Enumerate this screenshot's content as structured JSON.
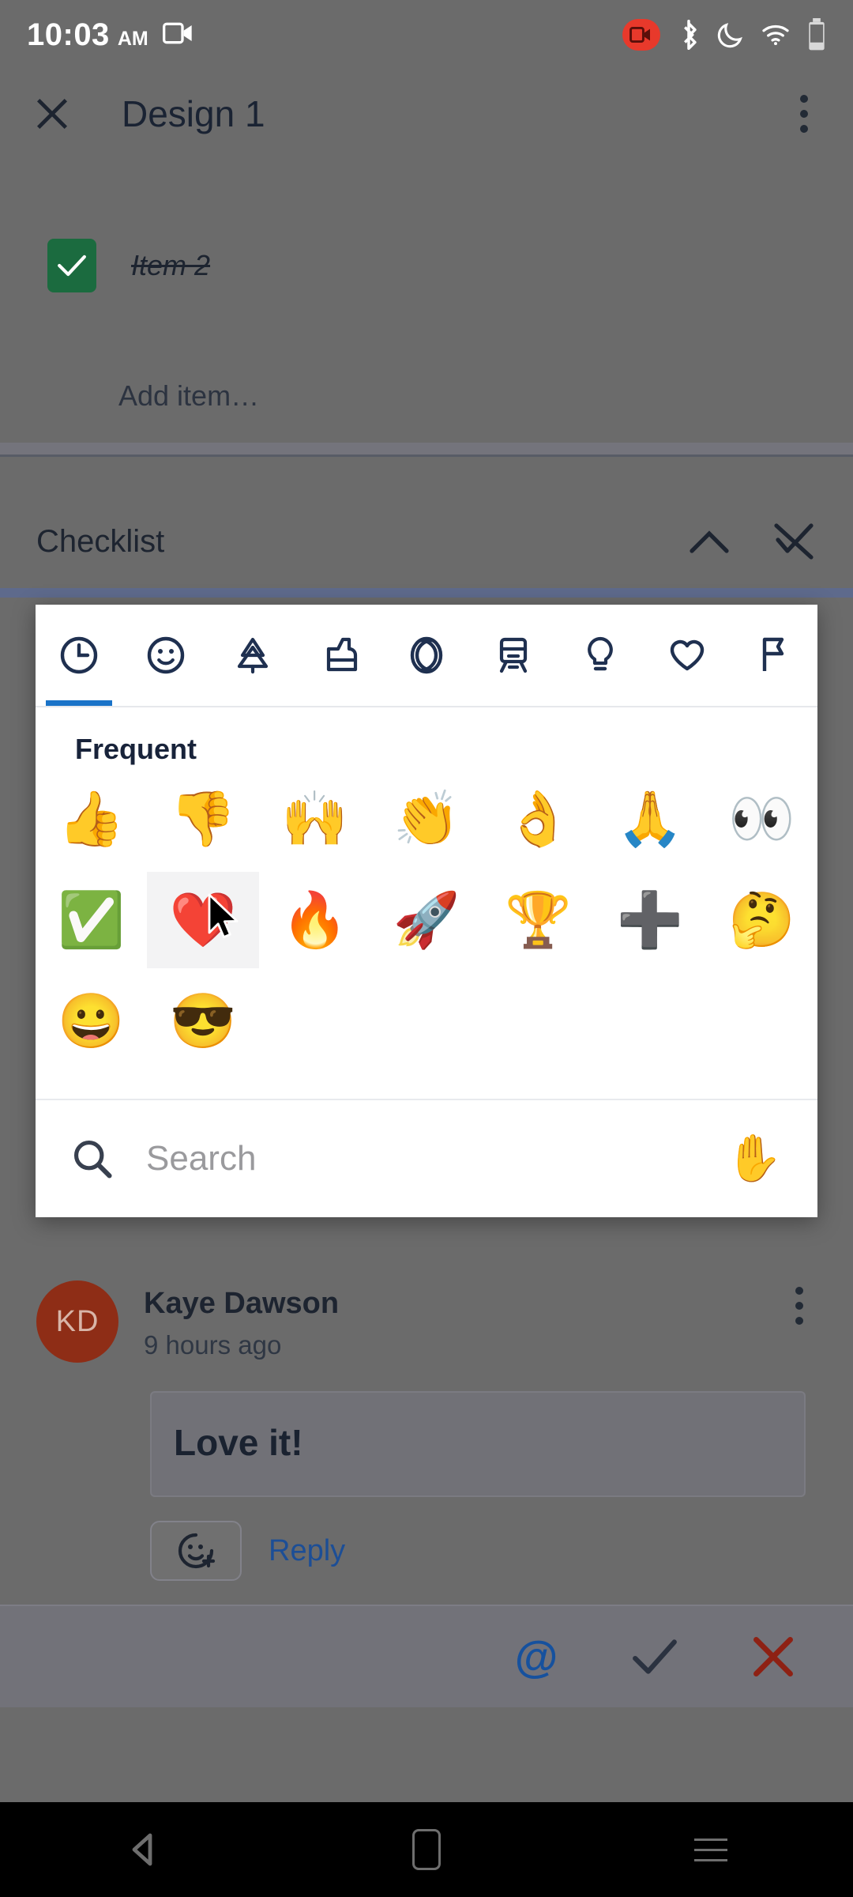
{
  "status_bar": {
    "time": "10:03",
    "meridiem": "AM",
    "icons": [
      "screen-record-icon",
      "recording-badge-icon",
      "bluetooth-icon",
      "do-not-disturb-icon",
      "wifi-icon",
      "battery-icon"
    ]
  },
  "app_header": {
    "close_label": "×",
    "title": "Design 1",
    "menu_label": "more-options"
  },
  "checklist_item": {
    "label": "Item 2",
    "checked": true,
    "add_placeholder": "Add item…"
  },
  "section": {
    "title": "Checklist",
    "collapse_label": "collapse",
    "hide_checked_label": "hide-checked-items"
  },
  "emoji_picker": {
    "categories": [
      {
        "name": "frequent",
        "icon": "clock-icon",
        "active": true
      },
      {
        "name": "smileys",
        "icon": "smiley-icon",
        "active": false
      },
      {
        "name": "nature",
        "icon": "tree-icon",
        "active": false
      },
      {
        "name": "food",
        "icon": "food-icon",
        "active": false
      },
      {
        "name": "activity",
        "icon": "ball-icon",
        "active": false
      },
      {
        "name": "travel",
        "icon": "train-icon",
        "active": false
      },
      {
        "name": "objects",
        "icon": "lightbulb-icon",
        "active": false
      },
      {
        "name": "symbols",
        "icon": "heart-icon",
        "active": false
      },
      {
        "name": "flags",
        "icon": "flag-icon",
        "active": false
      }
    ],
    "section_label": "Frequent",
    "emojis": [
      {
        "glyph": "👍",
        "name": "thumbs-up"
      },
      {
        "glyph": "👎",
        "name": "thumbs-down"
      },
      {
        "glyph": "🙌",
        "name": "raising-hands"
      },
      {
        "glyph": "👏",
        "name": "clapping-hands"
      },
      {
        "glyph": "👌",
        "name": "ok-hand"
      },
      {
        "glyph": "🙏",
        "name": "folded-hands"
      },
      {
        "glyph": "👀",
        "name": "eyes"
      },
      {
        "glyph": "✅",
        "name": "check-mark-button"
      },
      {
        "glyph": "❤️",
        "name": "red-heart"
      },
      {
        "glyph": "🔥",
        "name": "fire"
      },
      {
        "glyph": "🚀",
        "name": "rocket"
      },
      {
        "glyph": "🏆",
        "name": "trophy"
      },
      {
        "glyph": "➕",
        "name": "plus"
      },
      {
        "glyph": "🤔",
        "name": "thinking-face"
      },
      {
        "glyph": "😀",
        "name": "grinning-face"
      },
      {
        "glyph": "😎",
        "name": "smiling-face-with-sunglasses"
      }
    ],
    "hovered_index": 8,
    "search_placeholder": "Search",
    "skin_tone_glyph": "✋"
  },
  "comment": {
    "avatar_initials": "KD",
    "author": "Kaye Dawson",
    "timestamp": "9 hours ago",
    "text": "Love it!",
    "reply_label": "Reply",
    "react_label": "add-reaction",
    "menu_label": "more-options"
  },
  "bottom_bar": {
    "mention_label": "@",
    "confirm_label": "confirm",
    "cancel_label": "cancel"
  },
  "nav_bar": {
    "back_label": "back",
    "home_label": "home",
    "recents_label": "recents"
  },
  "colors": {
    "accent_blue": "#1a73c8",
    "link_blue": "#1c4e96",
    "checkbox_green": "#1b6b3f",
    "avatar_red": "#8e2d16",
    "cancel_red": "#8e2114",
    "recording_red": "#e8392b",
    "scrim": "#6b6b6b"
  }
}
